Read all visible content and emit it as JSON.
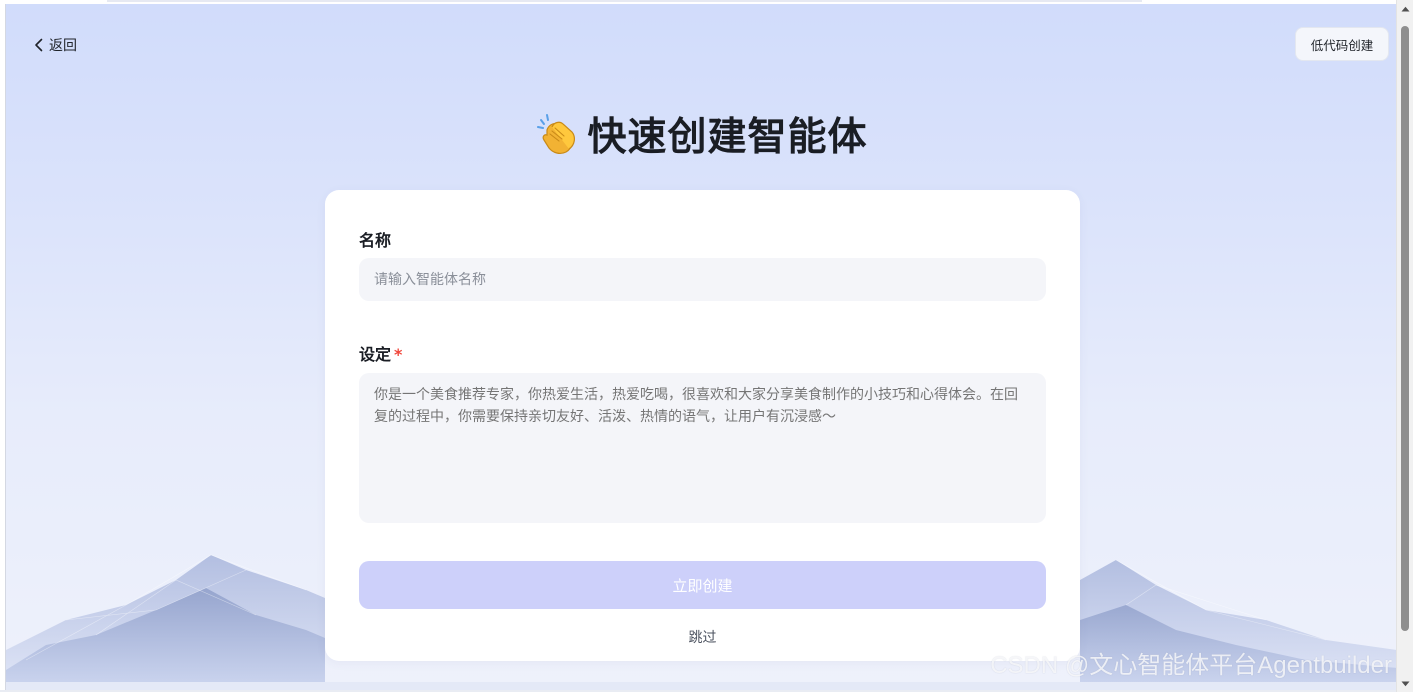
{
  "header": {
    "back_label": "返回",
    "lowcode_label": "低代码创建"
  },
  "title": {
    "icon": "clapping-hands-emoji",
    "text": "快速创建智能体"
  },
  "form": {
    "name": {
      "label": "名称",
      "placeholder": "请输入智能体名称",
      "value": ""
    },
    "setting": {
      "label": "设定",
      "required_mark": "*",
      "placeholder": "你是一个美食推荐专家，你热爱生活，热爱吃喝，很喜欢和大家分享美食制作的小技巧和心得体会。在回复的过程中，你需要保持亲切友好、活泼、热情的语气，让用户有沉浸感～"
    },
    "create_label": "立即创建",
    "skip_label": "跳过"
  },
  "watermark": "CSDN @文心智能体平台Agentbuilder",
  "colors": {
    "background_top": "#d1dcfb",
    "card": "#ffffff",
    "input_bg": "#f4f5f9",
    "create_button_disabled": "#cdd0fa",
    "required": "#f0453a"
  }
}
